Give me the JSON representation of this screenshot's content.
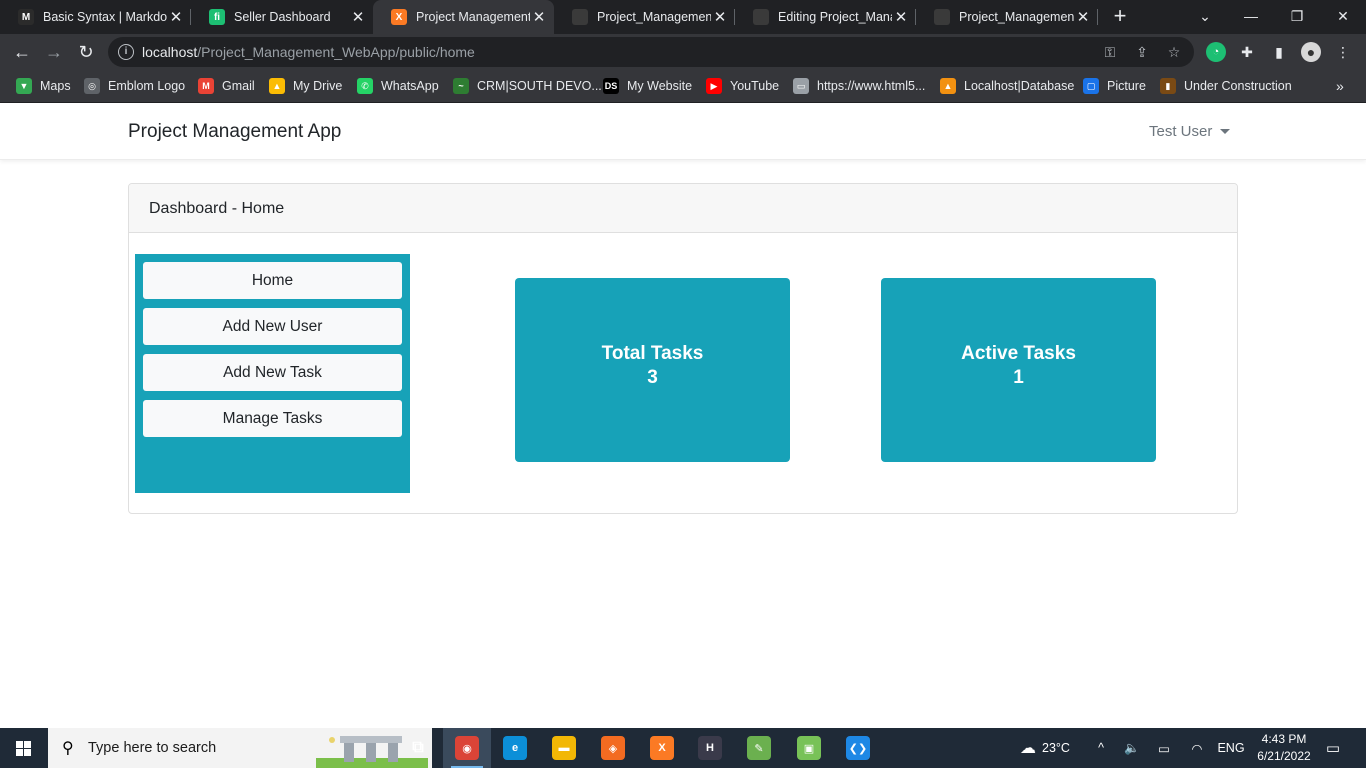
{
  "browser": {
    "tabs": [
      {
        "title": "Basic Syntax | Markdo",
        "icon": "markdown-icon",
        "color": "#2b2b2b",
        "glyph": "M"
      },
      {
        "title": "Seller Dashboard",
        "icon": "fiverr-icon",
        "color": "#1dbf73",
        "glyph": "fi"
      },
      {
        "title": "Project Management",
        "icon": "xampp-icon",
        "color": "#fb7a24",
        "glyph": "X"
      },
      {
        "title": "Project_Management_",
        "icon": "github-icon",
        "color": "#3a3a3a",
        "glyph": ""
      },
      {
        "title": "Editing Project_Manag",
        "icon": "github-icon",
        "color": "#3a3a3a",
        "glyph": ""
      },
      {
        "title": "Project_Management_",
        "icon": "github-icon",
        "color": "#3a3a3a",
        "glyph": ""
      }
    ],
    "active_tab": 2,
    "url_host": "localhost",
    "url_path": "/Project_Management_WebApp/public/home",
    "bookmarks": [
      {
        "label": "Maps",
        "icon": "maps-icon",
        "color": "#34a853",
        "glyph": "▼"
      },
      {
        "label": "Emblom Logo",
        "icon": "globe-icon",
        "color": "#5f6368",
        "glyph": "◎"
      },
      {
        "label": "Gmail",
        "icon": "gmail-icon",
        "color": "#ea4335",
        "glyph": "M"
      },
      {
        "label": "My Drive",
        "icon": "drive-icon",
        "color": "#fbbc04",
        "glyph": "▲"
      },
      {
        "label": "WhatsApp",
        "icon": "whatsapp-icon",
        "color": "#25d366",
        "glyph": "✆"
      },
      {
        "label": "CRM|SOUTH DEVO...",
        "icon": "crm-icon",
        "color": "#2e7d32",
        "glyph": "~"
      },
      {
        "label": "My Website",
        "icon": "ds-icon",
        "color": "#000000",
        "glyph": "DS"
      },
      {
        "label": "YouTube",
        "icon": "youtube-icon",
        "color": "#ff0000",
        "glyph": "▶"
      },
      {
        "label": "https://www.html5...",
        "icon": "page-icon",
        "color": "#9aa0a6",
        "glyph": "▭"
      },
      {
        "label": "Localhost|Database",
        "icon": "phpmyadmin-icon",
        "color": "#f29111",
        "glyph": "▲"
      },
      {
        "label": "Picture",
        "icon": "picture-icon",
        "color": "#1a73e8",
        "glyph": "▢"
      },
      {
        "label": "Under Construction",
        "icon": "construction-icon",
        "color": "#7a4a14",
        "glyph": "▮"
      }
    ]
  },
  "app": {
    "brand": "Project Management App",
    "user": "Test User",
    "card_title": "Dashboard - Home",
    "sidebar": [
      "Home",
      "Add New User",
      "Add New Task",
      "Manage Tasks"
    ],
    "stats": [
      {
        "label": "Total Tasks",
        "value": "3"
      },
      {
        "label": "Active Tasks",
        "value": "1"
      }
    ],
    "accent": "#17a2b8"
  },
  "taskbar": {
    "search_placeholder": "Type here to search",
    "weather": "23°C",
    "language": "ENG",
    "time": "4:43 PM",
    "date": "6/21/2022",
    "apps": [
      {
        "icon": "chrome-icon",
        "color": "#db4437",
        "glyph": "◉",
        "active": true
      },
      {
        "icon": "edge-icon",
        "color": "#0c8fd8",
        "glyph": "e",
        "active": false
      },
      {
        "icon": "file-explorer-icon",
        "color": "#f2b705",
        "glyph": "▬",
        "active": false
      },
      {
        "icon": "postman-icon",
        "color": "#f36b21",
        "glyph": "◈",
        "active": false
      },
      {
        "icon": "xampp-icon",
        "color": "#fb7a24",
        "glyph": "X",
        "active": false
      },
      {
        "icon": "hyper-icon",
        "color": "#3a3a4a",
        "glyph": "H",
        "active": false
      },
      {
        "icon": "notepad-icon",
        "color": "#6bb04f",
        "glyph": "✎",
        "active": false
      },
      {
        "icon": "android-icon",
        "color": "#78c257",
        "glyph": "▣",
        "active": false
      },
      {
        "icon": "vscode-icon",
        "color": "#1e88e5",
        "glyph": "❮❯",
        "active": false
      }
    ]
  }
}
